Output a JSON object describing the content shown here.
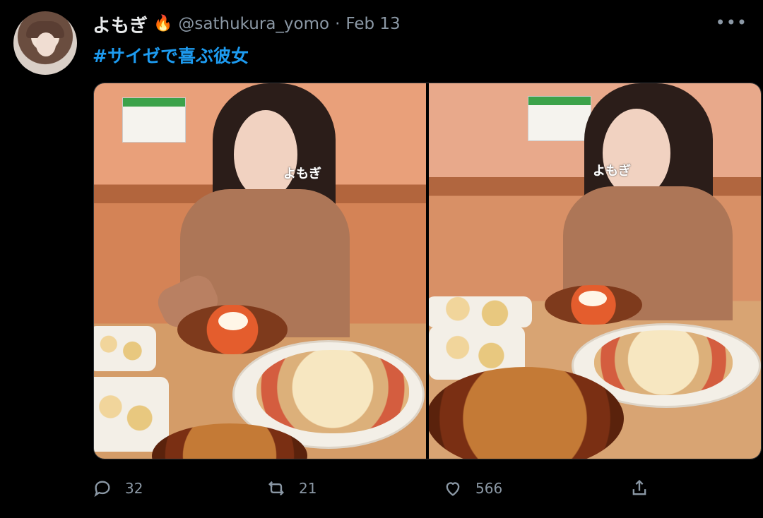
{
  "tweet": {
    "display_name": "よもぎ",
    "display_name_emoji": "fire",
    "handle": "@sathukura_yomo",
    "separator": "·",
    "date": "Feb 13",
    "text": "#サイゼで喜ぶ彼女",
    "more_icon": "more-horizontal-icon"
  },
  "media": {
    "images": [
      {
        "watermark": "よもぎ"
      },
      {
        "watermark": "よもぎ"
      }
    ]
  },
  "actions": {
    "reply_count": "32",
    "retweet_count": "21",
    "like_count": "566",
    "icons": {
      "reply": "reply-icon",
      "retweet": "retweet-icon",
      "like": "heart-icon",
      "share": "share-icon"
    }
  },
  "colors": {
    "background": "#000000",
    "text_primary": "#e7e9ea",
    "text_secondary": "#8b98a5",
    "link": "#1d9bf0"
  }
}
